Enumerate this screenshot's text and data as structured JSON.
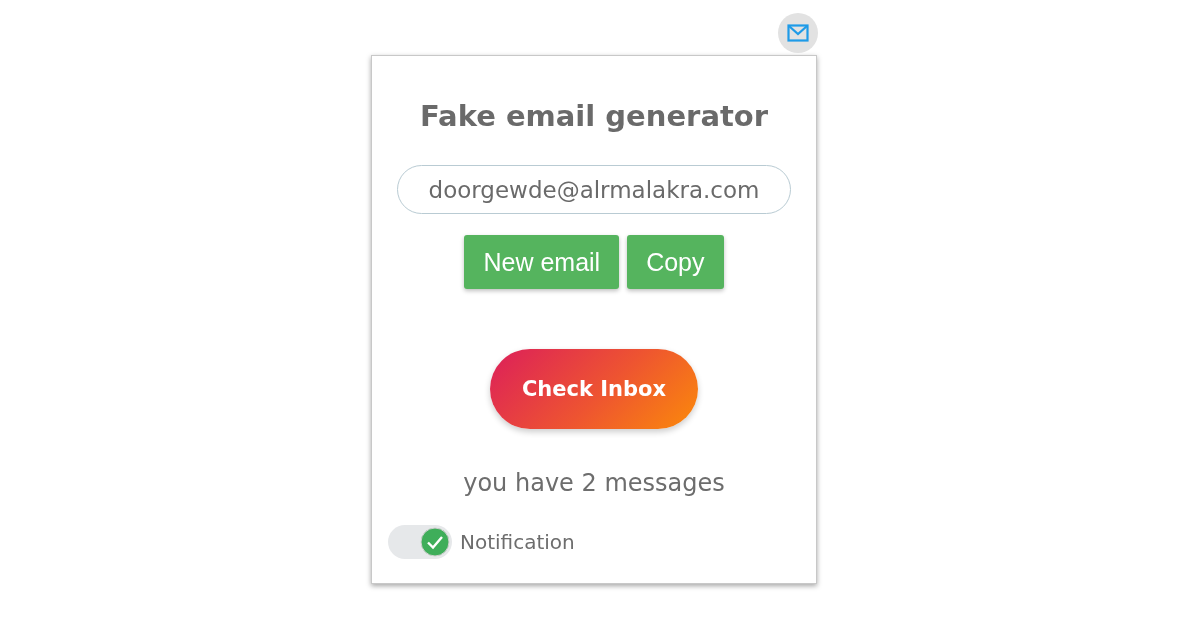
{
  "title": "Fake email generator",
  "email_field": {
    "value": "doorgewde@alrmalakra.com"
  },
  "buttons": [
    {
      "label": "New email",
      "kind": "flat"
    },
    {
      "label": "Copy",
      "kind": "flat"
    },
    {
      "label": "Check Inbox",
      "kind": "gradient"
    }
  ],
  "status": "you have 2 messages",
  "notification_toggle": {
    "label": "Notification",
    "on": true
  }
}
